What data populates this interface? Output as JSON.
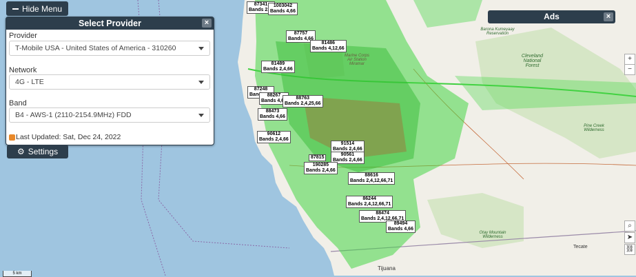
{
  "menu": {
    "hide_label": "Hide Menu",
    "settings_label": "Settings"
  },
  "panel": {
    "title": "Select Provider",
    "provider_label": "Provider",
    "provider_value": "T-Mobile USA - United States of America - 310260",
    "network_label": "Network",
    "network_value": "4G - LTE",
    "band_label": "Band",
    "band_value": "B4 - AWS-1 (2110-2154.9MHz) FDD",
    "last_updated": "Last Updated: Sat, Dec 24, 2022",
    "close": "×"
  },
  "ads": {
    "title": "Ads",
    "close": "×"
  },
  "towers": [
    {
      "id": "87341",
      "bands": "Bands 2,4,"
    },
    {
      "id": "1003042",
      "bands": "Bands 4,66"
    },
    {
      "id": "87757",
      "bands": "Bands 4,66"
    },
    {
      "id": "81486",
      "bands": "Bands 4,12,66"
    },
    {
      "id": "81489",
      "bands": "Bands 2,4,66"
    },
    {
      "id": "87248",
      "bands": "Bands 2,4"
    },
    {
      "id": "88267",
      "bands": "Bands 4,66"
    },
    {
      "id": "88763",
      "bands": "Bands 2,4,25,66"
    },
    {
      "id": "88473",
      "bands": "Bands 4,66"
    },
    {
      "id": "90612",
      "bands": "Bands 2,4,66"
    },
    {
      "id": "91514",
      "bands": "Bands 2,4,66"
    },
    {
      "id": "90561",
      "bands": "Bands 2,4,66"
    },
    {
      "id": "87815",
      "bands": ""
    },
    {
      "id": "190285",
      "bands": "Bands 2,4,66"
    },
    {
      "id": "88616",
      "bands": "Bands 2,4,12,66,71"
    },
    {
      "id": "86244",
      "bands": "Bands 2,4,12,66,71"
    },
    {
      "id": "88474",
      "bands": "Bands 2,4,12,66,71"
    },
    {
      "id": "89494",
      "bands": "Bands 4,66"
    }
  ],
  "map_labels": {
    "cleveland": "Cleveland National Forest",
    "pine_creek": "Pine Creek Wilderness",
    "otay": "Otay Mountain Wilderness",
    "tijuana": "Tijuana",
    "tecate": "Tecate",
    "miramar": "Marine Corps Air Station Miramar",
    "barona": "Barona Kumeyaay Reservation"
  },
  "controls": {
    "zoom_in": "+",
    "zoom_out": "−",
    "search": "⌕",
    "locate": "➤",
    "link": "⛓"
  },
  "scale": "5 km"
}
